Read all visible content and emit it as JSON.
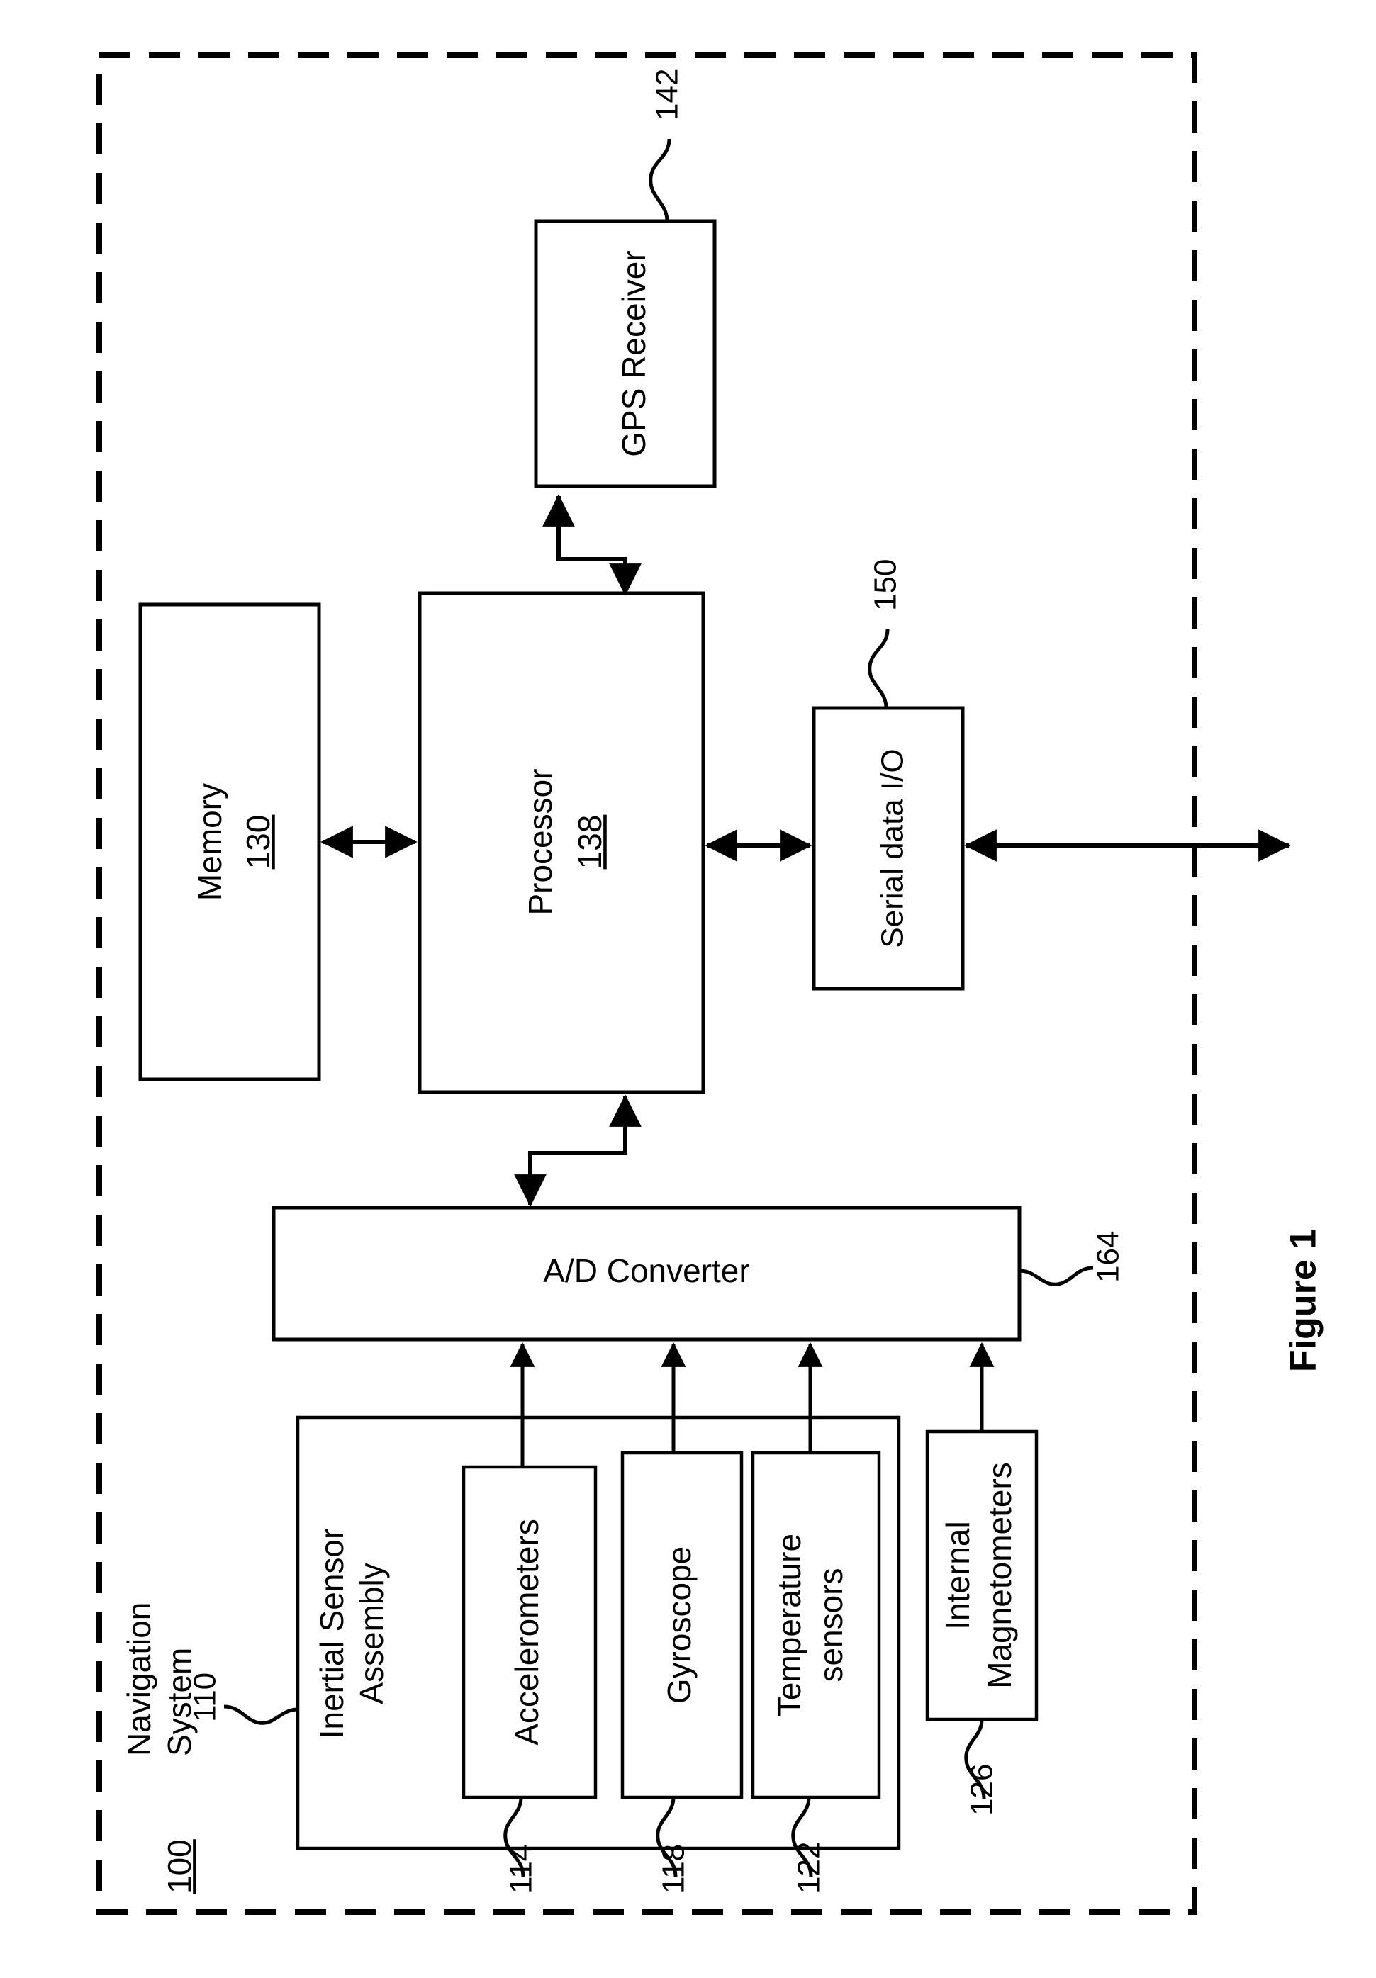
{
  "figure": {
    "caption": "Figure 1",
    "system_title_line1": "Navigation",
    "system_title_line2": "System",
    "system_ref": "100"
  },
  "blocks": {
    "gps_receiver": {
      "label": "GPS Receiver",
      "ref": "142"
    },
    "memory": {
      "label": "Memory",
      "ref": "130"
    },
    "processor": {
      "label": "Processor",
      "ref": "138"
    },
    "serial_io": {
      "label": "Serial data I/O",
      "ref": "150"
    },
    "ad_converter": {
      "label": "A/D Converter",
      "ref": "164"
    },
    "inertial_assembly": {
      "label_line1": "Inertial Sensor",
      "label_line2": "Assembly",
      "ref": "110"
    },
    "accelerometers": {
      "label": "Accelerometers",
      "ref": "114"
    },
    "gyroscope": {
      "label": "Gyroscope",
      "ref": "118"
    },
    "temperature_sensors": {
      "label_line1": "Temperature",
      "label_line2": "sensors",
      "ref": "122"
    },
    "internal_magnetometers": {
      "label_line1": "Internal",
      "label_line2": "Magnetometers",
      "ref": "126"
    }
  },
  "colors": {
    "line": "#000000",
    "background": "#ffffff"
  }
}
